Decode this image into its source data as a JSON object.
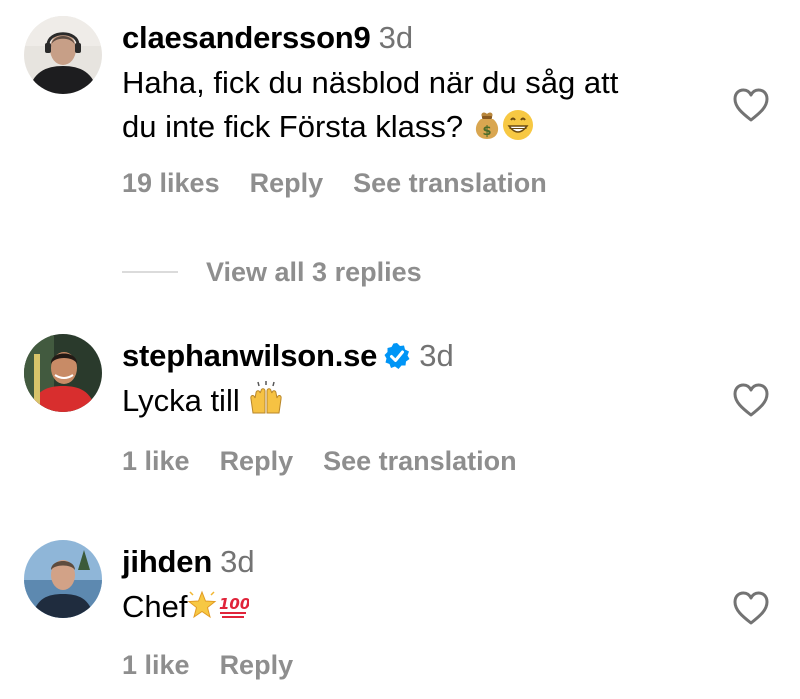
{
  "comments": [
    {
      "username": "claesandersson9",
      "time": "3d",
      "verified": false,
      "text_line1": "Haha, fick du näsblod när du såg att",
      "text_line2": "du inte fick Första klass?",
      "emojis": [
        "money-bag",
        "grinning-face"
      ],
      "likes": "19 likes",
      "reply": "Reply",
      "translate": "See translation",
      "view_replies": "View all 3 replies"
    },
    {
      "username": "stephanwilson.se",
      "time": "3d",
      "verified": true,
      "text": "Lycka till",
      "emojis": [
        "raising-hands"
      ],
      "likes": "1 like",
      "reply": "Reply",
      "translate": "See translation"
    },
    {
      "username": "jihden",
      "time": "3d",
      "verified": false,
      "text": "Chef",
      "emojis": [
        "glowing-star",
        "hundred-points"
      ],
      "likes": "1 like",
      "reply": "Reply"
    }
  ],
  "colors": {
    "text": "#000000",
    "muted": "#8e8e8e",
    "verified_blue": "#0095f6",
    "divider": "#dbdbdb"
  },
  "icons": [
    "heart-outline-icon",
    "verified-badge-icon"
  ]
}
